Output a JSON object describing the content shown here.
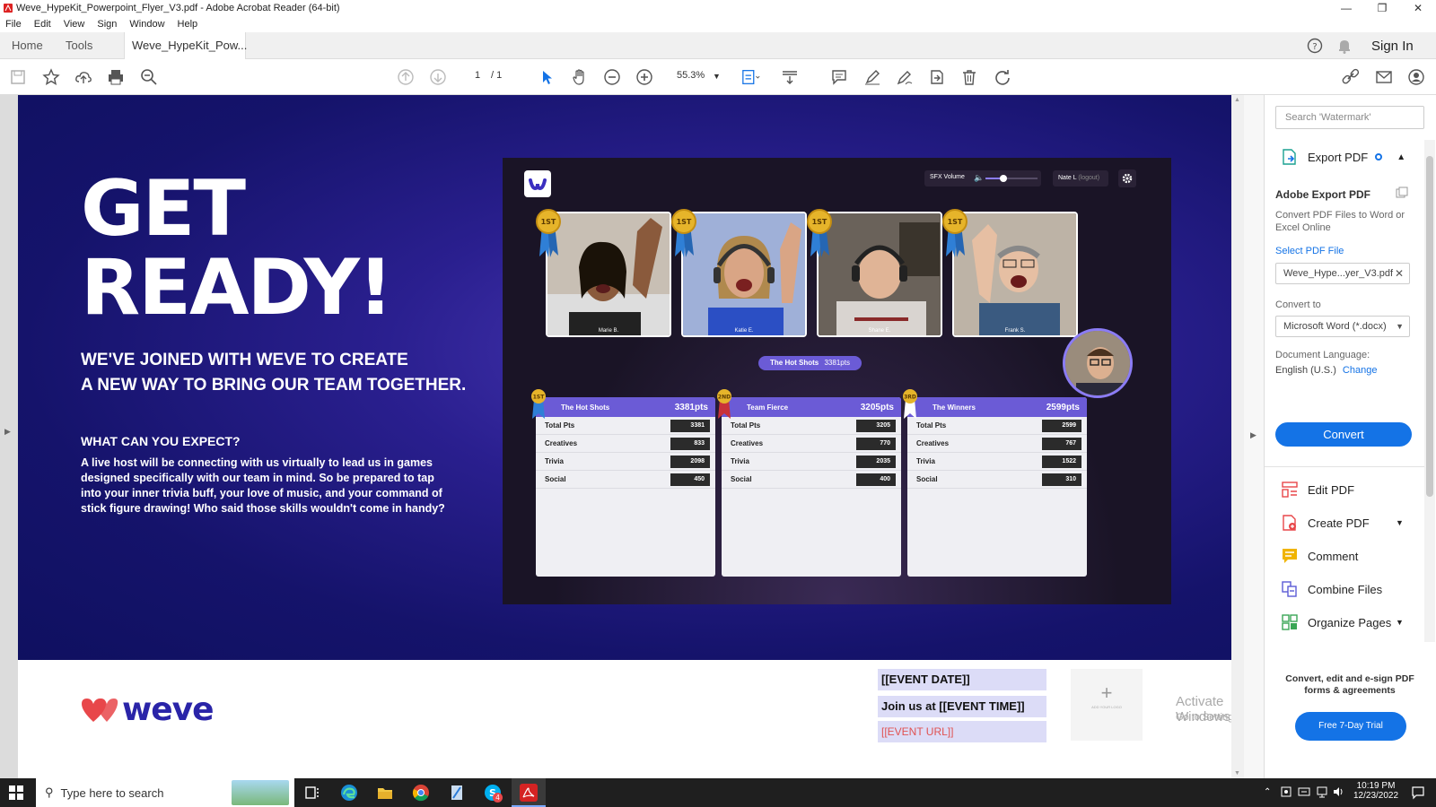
{
  "window": {
    "title": "Weve_HypeKit_Powerpoint_Flyer_V3.pdf - Adobe Acrobat Reader (64-bit)"
  },
  "menu": [
    "File",
    "Edit",
    "View",
    "Sign",
    "Window",
    "Help"
  ],
  "tabs": {
    "home": "Home",
    "tools": "Tools",
    "doc": "Weve_HypeKit_Pow...",
    "close": "×",
    "sign_in": "Sign In"
  },
  "toolbar": {
    "page_current": "1",
    "page_total": "/ 1",
    "zoom": "55.3%"
  },
  "flyer": {
    "title_line1": "GET",
    "title_line2": "READY!",
    "subtitle_line1": "WE'VE JOINED WITH WEVE TO CREATE",
    "subtitle_line2": "A NEW WAY TO BRING OUR TEAM TOGETHER.",
    "expect_heading": "WHAT CAN YOU EXPECT?",
    "expect_body": "A live host will be connecting with us virtually to lead us in games designed specifically with our team in mind. So be prepared to tap into your inner trivia buff, your love of music, and your command of stick figure drawing! Who said those skills wouldn't come in handy?",
    "brand": "weve",
    "event_date": "[[EVENT DATE]]",
    "event_time": "Join us at [[EVENT TIME]]",
    "event_url": "[[EVENT URL]]",
    "add_logo": "ADD YOUR LOGO",
    "plus": "+"
  },
  "game": {
    "sfx_label": "SFX Volume",
    "sfx_level": 0.35,
    "user": "Nate L",
    "logout": "(logout)",
    "leader_team": "The Hot Shots",
    "leader_pts": "3381pts",
    "players": [
      {
        "name": "Marie B.",
        "badge": "1ST",
        "skin": "#8a5a3c",
        "shirt": "#222"
      },
      {
        "name": "Katie E.",
        "badge": "1ST",
        "skin": "#d9a585",
        "shirt": "#2b4fc4"
      },
      {
        "name": "Shane E.",
        "badge": "1ST",
        "skin": "#e0b496",
        "shirt": "#d9d4d0"
      },
      {
        "name": "Frank S.",
        "badge": "1ST",
        "skin": "#e6bfa3",
        "shirt": "#3a5a80"
      }
    ],
    "teams": [
      {
        "rank": "1ST",
        "name": "The Hot Shots",
        "pts": "3381pts",
        "rows": [
          {
            "label": "Total Pts",
            "value": "3381"
          },
          {
            "label": "Creatives",
            "value": "833"
          },
          {
            "label": "Trivia",
            "value": "2098"
          },
          {
            "label": "Social",
            "value": "450"
          }
        ]
      },
      {
        "rank": "2ND",
        "name": "Team Fierce",
        "pts": "3205pts",
        "rows": [
          {
            "label": "Total Pts",
            "value": "3205"
          },
          {
            "label": "Creatives",
            "value": "770"
          },
          {
            "label": "Trivia",
            "value": "2035"
          },
          {
            "label": "Social",
            "value": "400"
          }
        ]
      },
      {
        "rank": "3RD",
        "name": "The Winners",
        "pts": "2599pts",
        "rows": [
          {
            "label": "Total Pts",
            "value": "2599"
          },
          {
            "label": "Creatives",
            "value": "767"
          },
          {
            "label": "Trivia",
            "value": "1522"
          },
          {
            "label": "Social",
            "value": "310"
          }
        ]
      }
    ]
  },
  "panel": {
    "search_placeholder": "Search 'Watermark'",
    "export_pdf": "Export PDF",
    "adobe_export": "Adobe Export PDF",
    "export_desc": "Convert PDF Files to Word or Excel Online",
    "select_file": "Select PDF File",
    "file_name": "Weve_Hype...yer_V3.pdf",
    "convert_to": "Convert to",
    "format": "Microsoft Word (*.docx)",
    "doc_language": "Document Language:",
    "language": "English (U.S.)",
    "change": "Change",
    "convert": "Convert",
    "tools": [
      "Edit PDF",
      "Create PDF",
      "Comment",
      "Combine Files",
      "Organize Pages"
    ],
    "promo": "Convert, edit and e-sign PDF forms & agreements",
    "trial": "Free 7-Day Trial",
    "activate_title": "Activate Windows",
    "activate_sub": "Go to Settings to activate Windows."
  },
  "taskbar": {
    "search": "Type here to search",
    "time": "10:19 PM",
    "date": "12/23/2022",
    "skype_badge": "4"
  },
  "colors": {
    "accent_blue": "#1473e6",
    "hero_navy": "#15136b",
    "brand_red": "#e8474a",
    "team_purple": "#6b5bd6"
  }
}
